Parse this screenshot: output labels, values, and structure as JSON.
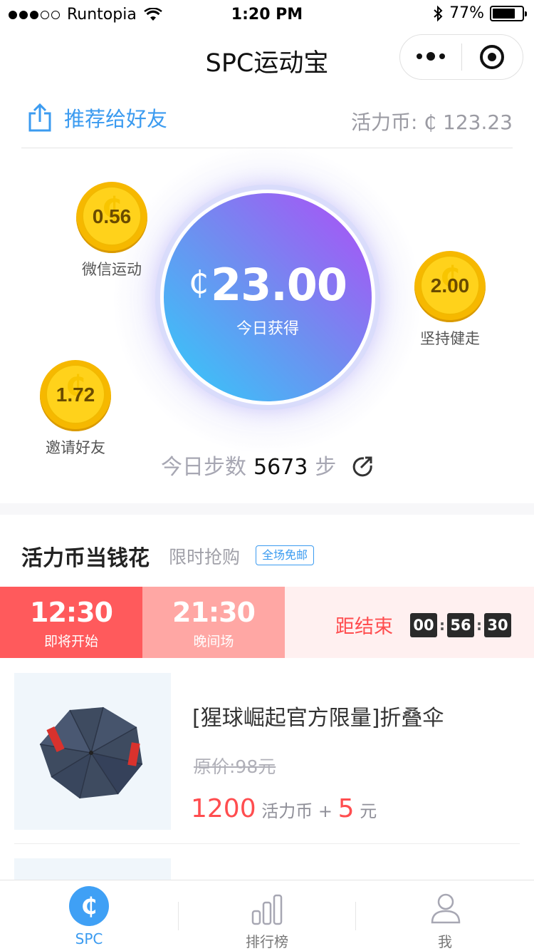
{
  "status_bar": {
    "carrier": "Runtopia",
    "time": "1:20 PM",
    "battery": "77%",
    "battery_fraction": 0.77
  },
  "nav": {
    "title": "SPC运动宝",
    "more_icon": "more-dots-icon",
    "close_icon": "target-close-icon"
  },
  "share": {
    "label": "推荐给好友",
    "icon": "share-icon"
  },
  "balance": {
    "label": "活力币: ₵ 123.23"
  },
  "hero": {
    "currency": "₵",
    "amount": "23.00",
    "label": "今日获得"
  },
  "coins": [
    {
      "value": "0.56",
      "label": "微信运动"
    },
    {
      "value": "2.00",
      "label": "坚持健走"
    },
    {
      "value": "1.72",
      "label": "邀请好友"
    }
  ],
  "steps": {
    "prefix": "今日步数",
    "count": "5673",
    "unit": "步"
  },
  "section": {
    "title": "活力币当钱花",
    "subtitle": "限时抢购",
    "tag": "全场免邮"
  },
  "timer": {
    "slots": [
      {
        "time": "12:30",
        "label": "即将开始"
      },
      {
        "time": "21:30",
        "label": "晚间场"
      }
    ],
    "countdown_label": "距结束",
    "hours": "00",
    "minutes": "56",
    "seconds": "30"
  },
  "product": {
    "title": "[猩球崛起官方限量]折叠伞",
    "original_price": "原价:98元",
    "coins_price": "1200",
    "coins_unit": "活力币",
    "plus": "+",
    "cash_price": "5",
    "cash_unit": "元"
  },
  "tabs": [
    {
      "label": "SPC",
      "active": true
    },
    {
      "label": "排行榜",
      "active": false
    },
    {
      "label": "我",
      "active": false
    }
  ],
  "colors": {
    "accent_blue": "#3b9bf0",
    "price_red": "#ff4d4f",
    "slot_active": "#ff5a5c",
    "slot_inactive": "#ffa7a4",
    "coin_gold": "#ffd21b"
  }
}
